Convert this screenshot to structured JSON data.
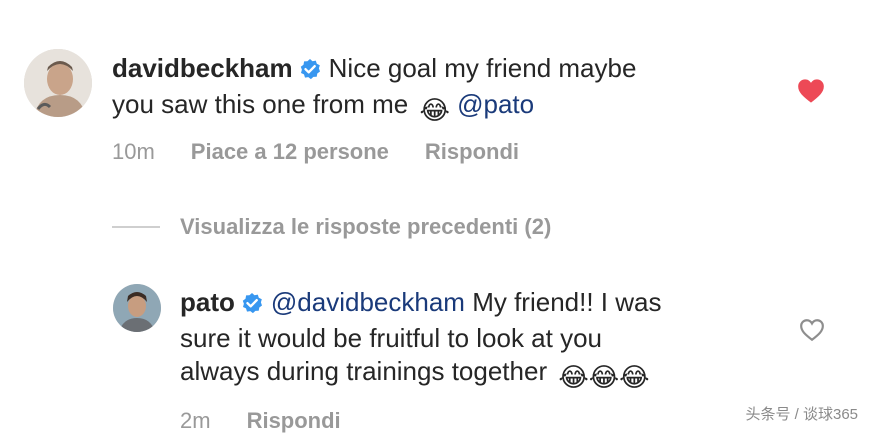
{
  "comments": [
    {
      "username": "davidbeckham",
      "text_1": "Nice goal my friend maybe",
      "text_2": "you saw this one from me",
      "emoji": "😂",
      "mention": "@pato",
      "time": "10m",
      "likes": "Piace a 12 persone",
      "reply": "Rispondi",
      "liked": true,
      "heart_color": "#ed4956"
    },
    {
      "username": "pato",
      "mention": "@davidbeckham",
      "text_1": "My friend!! I was",
      "text_2": "sure it would be fruitful to look at you",
      "text_3": "always during trainings together",
      "emoji": "😂😂😂",
      "time": "2m",
      "reply": "Rispondi",
      "liked": false
    }
  ],
  "view_previous_replies": "Visualizza le risposte precedenti (2)",
  "watermark": "头条号 / 谈球365",
  "colors": {
    "verified_badge": "#3897f0",
    "mention": "#1a3a7a",
    "meta_text": "#999999"
  }
}
